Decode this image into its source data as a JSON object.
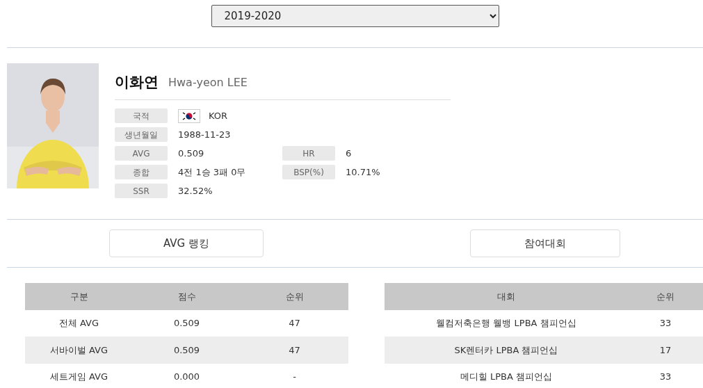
{
  "season_select": {
    "value": "2019-2020"
  },
  "player": {
    "name_ko": "이화연",
    "name_en": "Hwa-yeon LEE"
  },
  "info_rows": [
    {
      "cells": [
        {
          "label": "국적",
          "value": "KOR",
          "kind": "flag"
        }
      ]
    },
    {
      "cells": [
        {
          "label": "생년월일",
          "value": "1988-11-23",
          "kind": "text"
        }
      ]
    },
    {
      "cells": [
        {
          "label": "AVG",
          "value": "0.509",
          "kind": "text"
        },
        {
          "label": "HR",
          "value": "6",
          "kind": "text"
        }
      ]
    },
    {
      "cells": [
        {
          "label": "종합",
          "value": "4전 1승 3패 0무",
          "kind": "text"
        },
        {
          "label": "BSP(%)",
          "value": "10.71%",
          "kind": "text"
        }
      ]
    },
    {
      "cells": [
        {
          "label": "SSR",
          "value": "32.52%",
          "kind": "text"
        }
      ]
    }
  ],
  "buttons": [
    "AVG 랭킹",
    "참여대회"
  ],
  "avg_table": {
    "columns": [
      "구분",
      "점수",
      "순위"
    ],
    "rows": [
      [
        "전체 AVG",
        "0.509",
        "47"
      ],
      [
        "서바이벌 AVG",
        "0.509",
        "47"
      ],
      [
        "세트게임 AVG",
        "0.000",
        "-"
      ]
    ]
  },
  "tournament_table": {
    "columns": [
      "대회",
      "순위"
    ],
    "rows": [
      [
        "웰컴저축은행 웰뱅 LPBA 챔피언십",
        "33"
      ],
      [
        "SK렌터카 LPBA 챔피언십",
        "17"
      ],
      [
        "메디힐 LPBA 챔피언십",
        "33"
      ]
    ]
  }
}
